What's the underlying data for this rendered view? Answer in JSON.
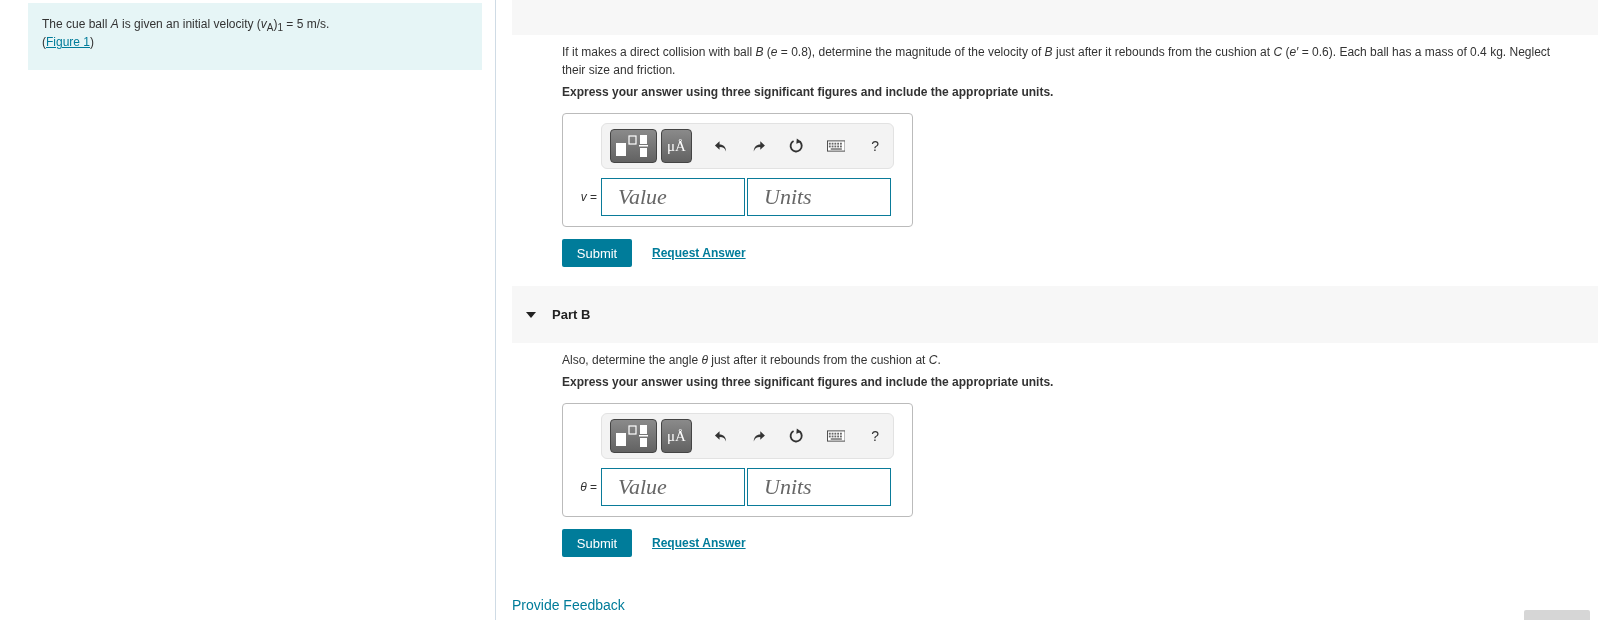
{
  "intro": {
    "text": "The cue ball *A* is given an initial velocity (*v*$_{A}$)$_{1}$ = 5 m/s.",
    "figure_open": "(",
    "figure_link": "Figure 1",
    "figure_close": ")"
  },
  "parts": [
    {
      "question": "If it makes a direct collision with ball *B* (*e* = 0.8), determine the magnitude of the velocity of *B* just after it rebounds from the cushion at *C* (*e′* = 0.6). Each ball has a mass of 0.4 kg. Neglect their size and friction.",
      "instruction": "Express your answer using three significant figures and include the appropriate units.",
      "units_label": "μÅ",
      "help": "?",
      "variable": "*v* =",
      "value_placeholder": "Value",
      "units_placeholder": "Units",
      "submit": "Submit",
      "request": "Request Answer"
    },
    {
      "title": "Part B",
      "expanded": true,
      "question": "Also, determine the angle *θ* just after it rebounds from the cushion at *C*.",
      "instruction": "Express your answer using three significant figures and include the appropriate units.",
      "units_label": "μÅ",
      "help": "?",
      "variable": "*θ* =",
      "value_placeholder": "Value",
      "units_placeholder": "Units",
      "submit": "Submit",
      "request": "Request Answer"
    }
  ],
  "feedback_link": "Provide Feedback"
}
